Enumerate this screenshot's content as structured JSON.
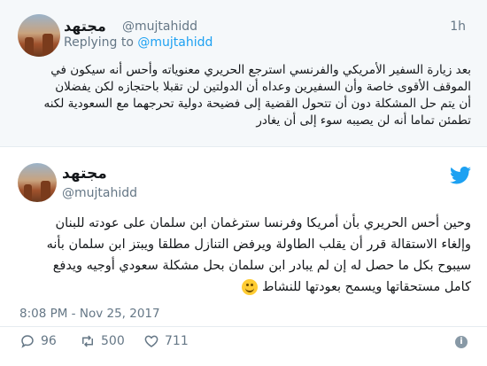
{
  "reply_tweet": {
    "name": "مجتهد",
    "handle": "@mujtahidd",
    "time": "1h",
    "replying_prefix": "Replying to",
    "replying_handle": "@mujtahidd",
    "lines": [
      "بعد زيارة السفير الأمريكي والفرنسي استرجع الحريري معنوياته وأحس أنه سيكون في",
      "الموقف الأقوى خاصة وأن السفيرين وعداه أن الدولتين لن تقبلا باحتجازه لكن يفضلان",
      "أن يتم حل المشكلة دون أن تتحول القضية إلى فضيحة دولية تحرجهما مع السعودية لكنه",
      "تطمئن تماما أنه لن يصيبه سوء إلى أن يغادر"
    ]
  },
  "main_tweet": {
    "name": "مجتهد",
    "handle": "@mujtahidd",
    "lines": [
      "وحين أحس الحريري بأن أمريكا وفرنسا سترغمان ابن سلمان على عودته للبنان",
      "وإلغاء الاستقالة قرر أن يقلب الطاولة ويرفض التنازل مطلقا ويبتز ابن سلمان بأنه",
      "سيبوح بكل ما حصل له إن لم يبادر ابن سلمان بحل مشكلة سعودي أوجيه ويدفع",
      "كامل مستحقاتها ويسمح بعودتها للنشاط"
    ],
    "emoji": "slightly-smiling-face",
    "timestamp": "8:08 PM - Nov 25, 2017",
    "reply_count": "96",
    "retweet_count": "500",
    "like_count": "711",
    "colors": {
      "accent": "#1da1f2",
      "muted": "#657786",
      "reply_bg": "#f5f8fa"
    }
  }
}
